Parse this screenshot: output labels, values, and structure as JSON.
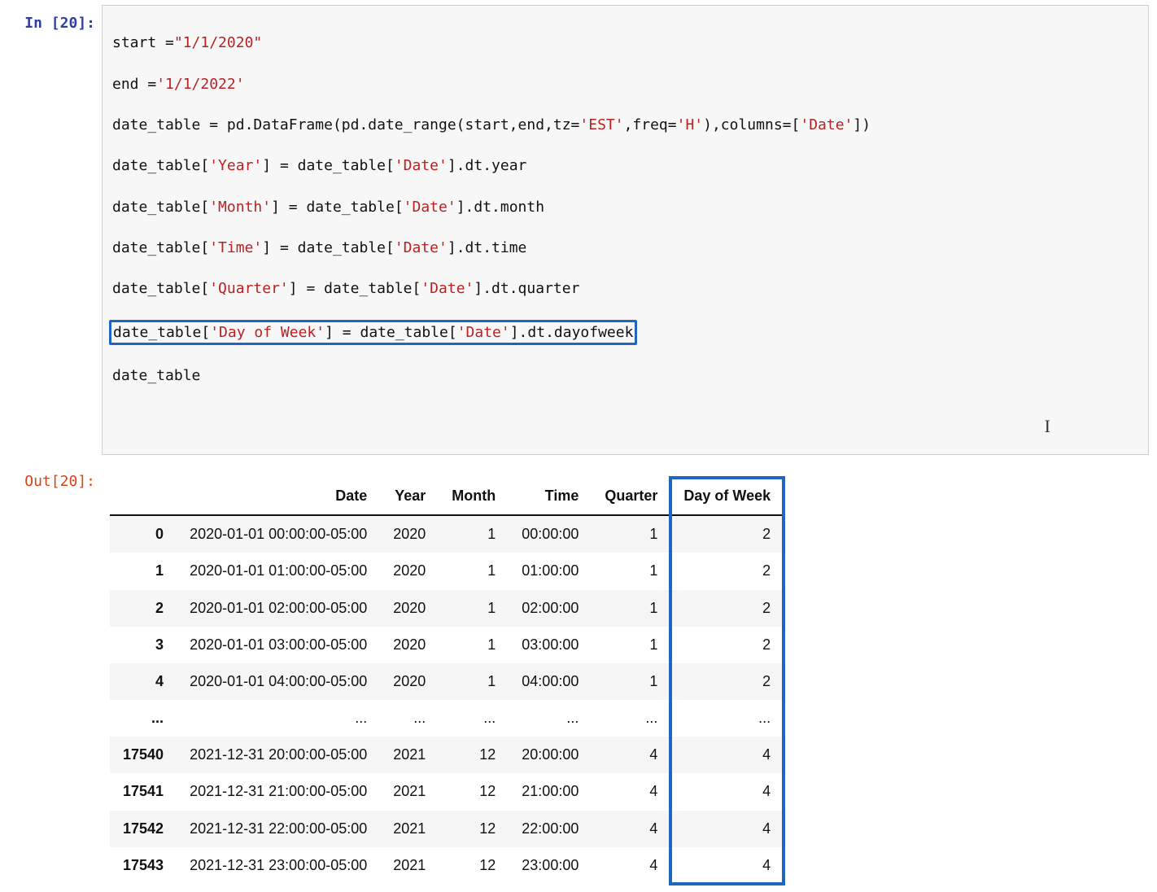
{
  "cell": {
    "in_label": "In [20]:",
    "out_label": "Out[20]:",
    "code": {
      "l1a": "start ",
      "l1b": "=",
      "l1c": "\"1/1/2020\"",
      "l2a": "end ",
      "l2b": "=",
      "l2c": "'1/1/2022'",
      "l3a": "date_table ",
      "l3b": "=",
      "l3c": " pd.DataFrame(pd.date_range(start,end,tz",
      "l3d": "=",
      "l3e": "'EST'",
      "l3f": ",freq",
      "l3g": "=",
      "l3h": "'H'",
      "l3i": "),columns",
      "l3j": "=",
      "l3k": "[",
      "l3l": "'Date'",
      "l3m": "])",
      "l4a": "date_table[",
      "l4b": "'Year'",
      "l4c": "] ",
      "l4d": "=",
      "l4e": " date_table[",
      "l4f": "'Date'",
      "l4g": "].dt.year",
      "l5a": "date_table[",
      "l5b": "'Month'",
      "l5c": "] ",
      "l5d": "=",
      "l5e": " date_table[",
      "l5f": "'Date'",
      "l5g": "].dt.month",
      "l6a": "date_table[",
      "l6b": "'Time'",
      "l6c": "] ",
      "l6d": "=",
      "l6e": " date_table[",
      "l6f": "'Date'",
      "l6g": "].dt.time",
      "l7a": "date_table[",
      "l7b": "'Quarter'",
      "l7c": "] ",
      "l7d": "=",
      "l7e": " date_table[",
      "l7f": "'Date'",
      "l7g": "].dt.quarter",
      "l8a": "date_table[",
      "l8b": "'Day of Week'",
      "l8c": "] ",
      "l8d": "=",
      "l8e": " date_table[",
      "l8f": "'Date'",
      "l8g": "].dt.dayofweek",
      "l9": "date_table"
    }
  },
  "table": {
    "columns": [
      "Date",
      "Year",
      "Month",
      "Time",
      "Quarter",
      "Day of Week"
    ],
    "highlight_column": "Day of Week",
    "rows": [
      {
        "idx": "0",
        "date": "2020-01-01 00:00:00-05:00",
        "year": "2020",
        "month": "1",
        "time": "00:00:00",
        "quarter": "1",
        "dow": "2"
      },
      {
        "idx": "1",
        "date": "2020-01-01 01:00:00-05:00",
        "year": "2020",
        "month": "1",
        "time": "01:00:00",
        "quarter": "1",
        "dow": "2"
      },
      {
        "idx": "2",
        "date": "2020-01-01 02:00:00-05:00",
        "year": "2020",
        "month": "1",
        "time": "02:00:00",
        "quarter": "1",
        "dow": "2"
      },
      {
        "idx": "3",
        "date": "2020-01-01 03:00:00-05:00",
        "year": "2020",
        "month": "1",
        "time": "03:00:00",
        "quarter": "1",
        "dow": "2"
      },
      {
        "idx": "4",
        "date": "2020-01-01 04:00:00-05:00",
        "year": "2020",
        "month": "1",
        "time": "04:00:00",
        "quarter": "1",
        "dow": "2"
      },
      {
        "idx": "...",
        "date": "...",
        "year": "...",
        "month": "...",
        "time": "...",
        "quarter": "...",
        "dow": "..."
      },
      {
        "idx": "17540",
        "date": "2021-12-31 20:00:00-05:00",
        "year": "2021",
        "month": "12",
        "time": "20:00:00",
        "quarter": "4",
        "dow": "4"
      },
      {
        "idx": "17541",
        "date": "2021-12-31 21:00:00-05:00",
        "year": "2021",
        "month": "12",
        "time": "21:00:00",
        "quarter": "4",
        "dow": "4"
      },
      {
        "idx": "17542",
        "date": "2021-12-31 22:00:00-05:00",
        "year": "2021",
        "month": "12",
        "time": "22:00:00",
        "quarter": "4",
        "dow": "4"
      },
      {
        "idx": "17543",
        "date": "2021-12-31 23:00:00-05:00",
        "year": "2021",
        "month": "12",
        "time": "23:00:00",
        "quarter": "4",
        "dow": "4"
      }
    ]
  }
}
